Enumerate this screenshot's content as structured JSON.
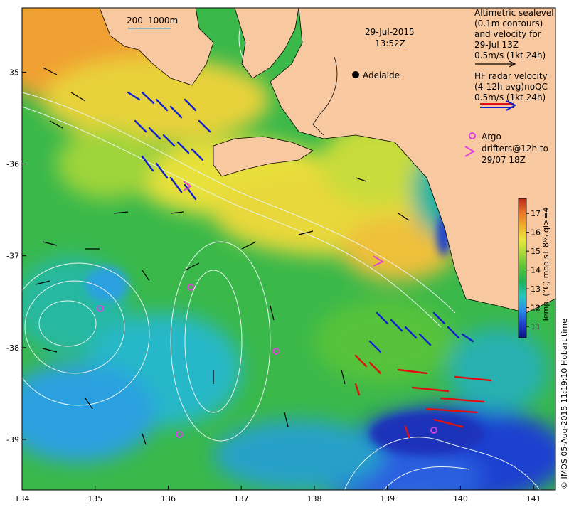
{
  "map": {
    "date": "29-Jul-2015",
    "time": "13:52Z",
    "city": "Adelaide",
    "depth_contours": [
      "200",
      "1000m"
    ],
    "lon_ticks": [
      "134",
      "135",
      "136",
      "137",
      "138",
      "139",
      "140",
      "141"
    ],
    "lat_ticks": [
      "-35",
      "-36",
      "-37",
      "-38",
      "-39"
    ],
    "lon_range": [
      134,
      141.3
    ],
    "lat_range": [
      -39.55,
      -34.3
    ],
    "credit": "© IMOS 05-Aug-2015 11:19:10 Hobart time"
  },
  "legend": {
    "altimetry": [
      "Altimetric sealevel",
      "(0.1m contours)",
      "and velocity for",
      "29-Jul 13Z",
      "0.5m/s (1kt 24h)"
    ],
    "hf_radar": [
      "HF radar velocity",
      "(4-12h avg)noQC",
      "0.5m/s (1kt 24h)"
    ],
    "argo": [
      "Argo",
      "drifters@12h to",
      "29/07 18Z"
    ]
  },
  "colorbar": {
    "label": "Temp. (°C) modisT 8% ql>=4",
    "ticks": [
      "11",
      "12",
      "13",
      "14",
      "15",
      "16",
      "17"
    ],
    "min": 10.4,
    "max": 17.8,
    "colors": [
      "#0a1580",
      "#1f3fd0",
      "#2a90e8",
      "#28c7c0",
      "#1fb35a",
      "#57c23a",
      "#a4d43a",
      "#e8e83a",
      "#f0b02a",
      "#e8742a",
      "#b8281a"
    ]
  },
  "colors": {
    "land": "#f8c8a0",
    "altimetry_arrow": "#000000",
    "hf_arrow_a": "#1020d0",
    "hf_arrow_b": "#e01010",
    "argo": "#e040e0",
    "contour": "#e8f4f0"
  }
}
